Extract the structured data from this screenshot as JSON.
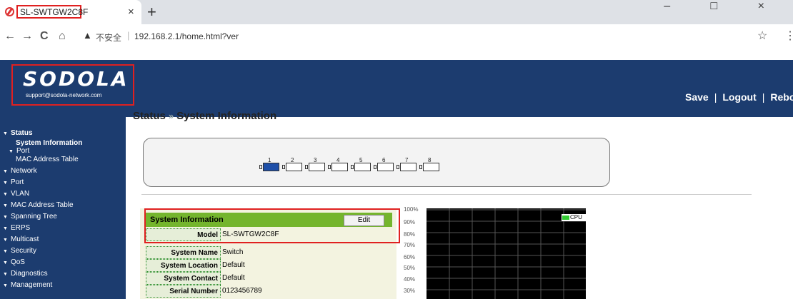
{
  "browser": {
    "tab_title": "SL-SWTGW2C8F",
    "tab_close": "×",
    "new_tab": "+",
    "window_controls": "– □ ×",
    "nav_back": "←",
    "nav_forward": "→",
    "nav_reload": "C",
    "nav_home": "⌂",
    "warning_glyph": "▲",
    "insecure_label": "不安全",
    "url": "192.168.2.1/home.html?ver",
    "bookmark_star": "☆",
    "menu": "⋮"
  },
  "header": {
    "logo_text": "SODOLA",
    "logo_email": "support@sodola-network.com",
    "save": "Save",
    "logout": "Logout",
    "reboot": "Reboot",
    "separator": "|",
    "bg_color": "#1c3c6f"
  },
  "sidebar": {
    "items": [
      {
        "label": "Status",
        "indent": 0,
        "bold": true
      },
      {
        "label": "System Information",
        "indent": 1,
        "bold": true
      },
      {
        "label": "Port",
        "indent": 1,
        "bold": false
      },
      {
        "label": "MAC Address Table",
        "indent": 2,
        "bold": false
      },
      {
        "label": "Network",
        "indent": 0,
        "bold": false
      },
      {
        "label": "Port",
        "indent": 0,
        "bold": false
      },
      {
        "label": "VLAN",
        "indent": 0,
        "bold": false
      },
      {
        "label": "MAC Address Table",
        "indent": 0,
        "bold": false
      },
      {
        "label": "Spanning Tree",
        "indent": 0,
        "bold": false
      },
      {
        "label": "ERPS",
        "indent": 0,
        "bold": false
      },
      {
        "label": "Multicast",
        "indent": 0,
        "bold": false
      },
      {
        "label": "Security",
        "indent": 0,
        "bold": false
      },
      {
        "label": "QoS",
        "indent": 0,
        "bold": false
      },
      {
        "label": "Diagnostics",
        "indent": 0,
        "bold": false
      },
      {
        "label": "Management",
        "indent": 0,
        "bold": false
      }
    ]
  },
  "main": {
    "breadcrumb_section": "Status",
    "breadcrumb_sep": "»",
    "breadcrumb_page": "System Information",
    "ports": [
      "1",
      "2",
      "3",
      "4",
      "5",
      "6",
      "7",
      "8"
    ],
    "active_port": "1"
  },
  "info_table": {
    "title": "System Information",
    "edit_label": "Edit",
    "rows": [
      {
        "key": "Model",
        "value": "SL-SWTGW2C8F"
      },
      {
        "key": "System Name",
        "value": "Switch"
      },
      {
        "key": "System Location",
        "value": "Default"
      },
      {
        "key": "System Contact",
        "value": "Default"
      },
      {
        "key": "Serial Number",
        "value": "0123456789"
      }
    ]
  },
  "cpu_chart": {
    "legend": "CPU",
    "y_ticks": [
      "100%",
      "90%",
      "80%",
      "70%",
      "60%",
      "50%",
      "40%",
      "30%"
    ],
    "line_color": "#33cc33"
  }
}
